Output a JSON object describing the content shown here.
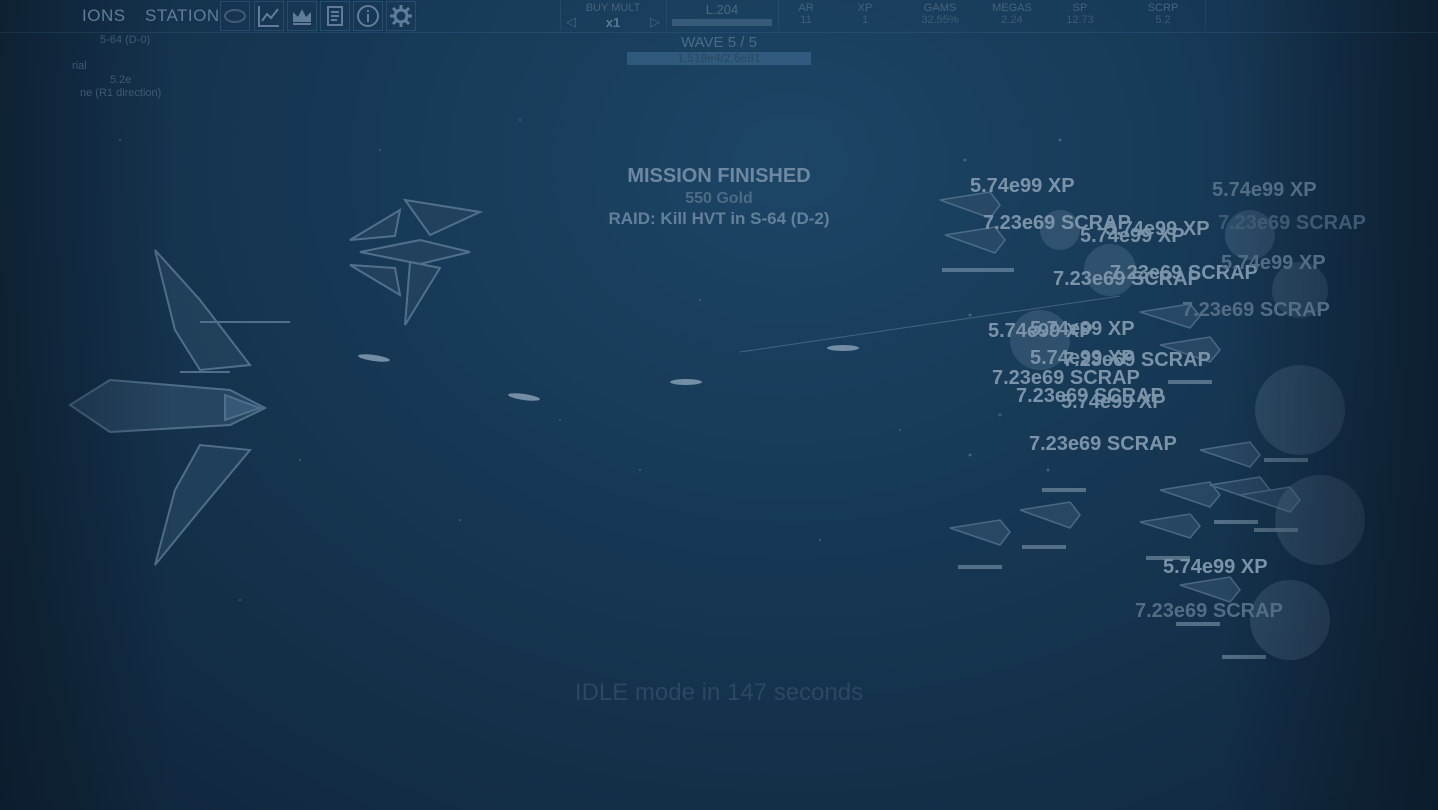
{
  "topbar": {
    "nav_missions": "IONS",
    "nav_station": "STATION",
    "buy_mult_label": "BUY MULT",
    "buy_mult_value": "x1",
    "level": "L.204",
    "stats": [
      {
        "label": "AR",
        "value": "11"
      },
      {
        "label": "XP",
        "value": "1"
      },
      {
        "label": "GAMS",
        "value": "32.55%"
      },
      {
        "label": "MEGAS",
        "value": "2.24"
      },
      {
        "label": "SP",
        "value": "12.73"
      },
      {
        "label": "SCRP",
        "value": "5.2"
      }
    ]
  },
  "wave": {
    "label": "WAVE 5 / 5",
    "progress_text": "1.518e4/2.6e81"
  },
  "sector_info": [
    "5-64 (D-0)",
    "rial",
    "5.2e",
    "ne (R1 direction)"
  ],
  "mission": {
    "title": "MISSION FINISHED",
    "reward": "550 Gold",
    "raid": "RAID: Kill HVT in S-64 (D-2)"
  },
  "idle_text": "IDLE mode in 147 seconds",
  "floating_texts": [
    {
      "text": "5.74e99 XP",
      "tone": "bright"
    },
    {
      "text": "7.23e69 SCRAP",
      "tone": "bright"
    },
    {
      "text": "5.74e99 XP",
      "tone": "bright"
    },
    {
      "text": "5.74e99 XP",
      "tone": "bright"
    },
    {
      "text": "7.23e69 SCRAP",
      "tone": "bright"
    },
    {
      "text": "7.23e69 SCRAP",
      "tone": "bright"
    },
    {
      "text": "5.74e99 XP",
      "tone": "bright"
    },
    {
      "text": "5.74e99 XP",
      "tone": "bright"
    },
    {
      "text": "7.23e69 SCRAP",
      "tone": "bright"
    },
    {
      "text": "5.74e99 XP",
      "tone": "bright"
    },
    {
      "text": "7.23e69 SCRAP",
      "tone": "bright"
    },
    {
      "text": "7.23e69 SCRAP",
      "tone": "bright"
    },
    {
      "text": "5.74e99 XP",
      "tone": "bright"
    },
    {
      "text": "7.23e69 SCRAP",
      "tone": "bright"
    },
    {
      "text": "5.74e99 XP",
      "tone": "bright"
    },
    {
      "text": "7.23e69 SCRAP",
      "tone": "dim"
    },
    {
      "text": "5.74e99 XP",
      "tone": "dim"
    },
    {
      "text": "7.23e69 SCRAP",
      "tone": "dim"
    },
    {
      "text": "5.74e99 XP",
      "tone": "dim"
    },
    {
      "text": "7.23e69 SCRAP",
      "tone": "dim"
    }
  ]
}
